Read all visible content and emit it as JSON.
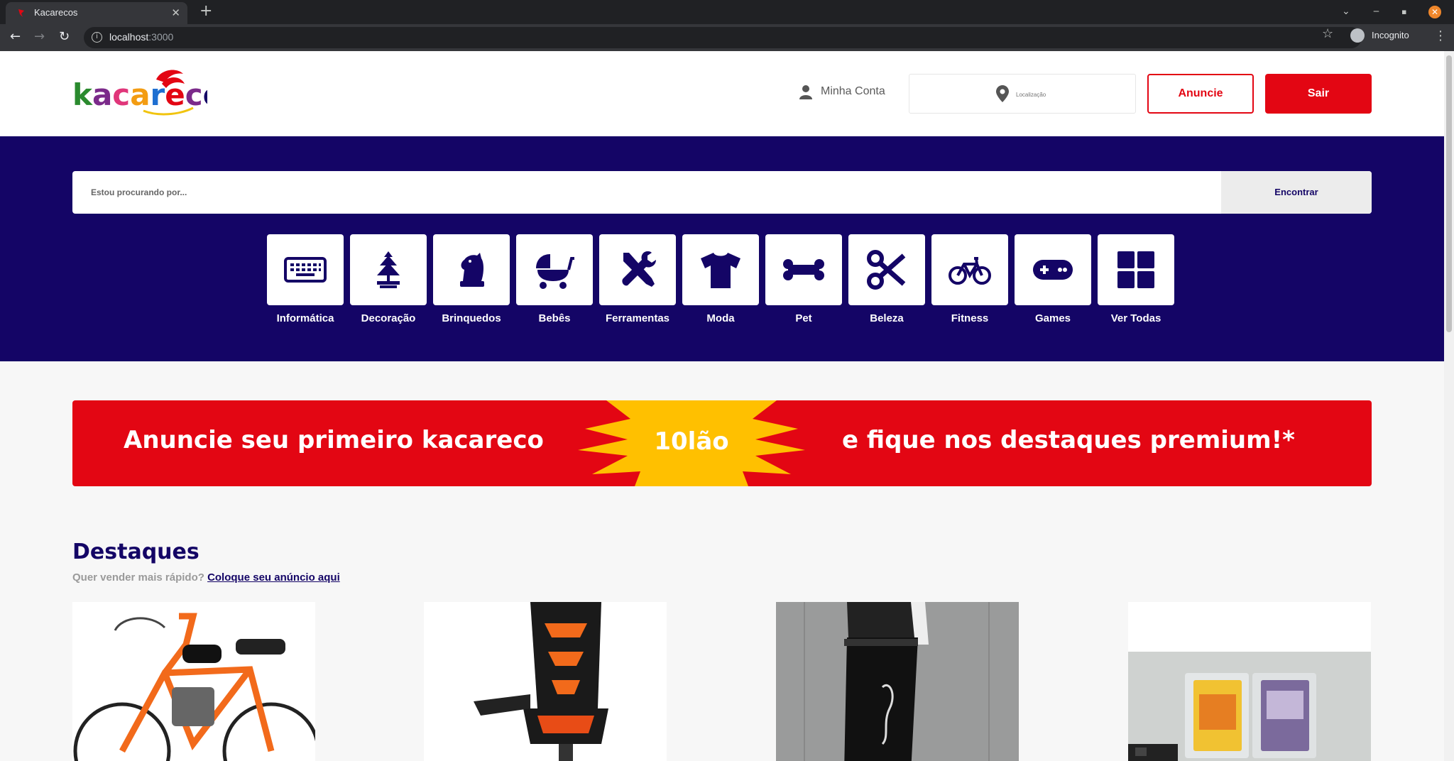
{
  "browser": {
    "tab_title": "Kacarecos",
    "url_host": "localhost",
    "url_port": ":3000",
    "profile_label": "Incognito"
  },
  "header": {
    "account_label": "Minha Conta",
    "location_placeholder": "Localização",
    "announce_label": "Anuncie",
    "logout_label": "Sair"
  },
  "search": {
    "placeholder": "Estou procurando por...",
    "button_label": "Encontrar"
  },
  "categories": [
    {
      "label": "Informática",
      "icon": "keyboard-icon"
    },
    {
      "label": "Decoração",
      "icon": "lamp-icon"
    },
    {
      "label": "Brinquedos",
      "icon": "chess-knight-icon"
    },
    {
      "label": "Bebês",
      "icon": "baby-carriage-icon"
    },
    {
      "label": "Ferramentas",
      "icon": "tools-icon"
    },
    {
      "label": "Moda",
      "icon": "tshirt-icon"
    },
    {
      "label": "Pet",
      "icon": "bone-icon"
    },
    {
      "label": "Beleza",
      "icon": "scissors-icon"
    },
    {
      "label": "Fitness",
      "icon": "bicycle-icon"
    },
    {
      "label": "Games",
      "icon": "gamepad-icon"
    },
    {
      "label": "Ver Todas",
      "icon": "grid-icon"
    }
  ],
  "banner": {
    "left_text": "Anuncie seu primeiro kacareco",
    "center_text": "10lão",
    "right_text": "e fique nos destaques premium!*"
  },
  "featured": {
    "title": "Destaques",
    "prompt": "Quer vender mais rápido?",
    "link_label": "Coloque seu anúncio aqui"
  },
  "colors": {
    "brand_navy": "#140566",
    "brand_red": "#e30613",
    "banner_yellow": "#ffc000"
  }
}
